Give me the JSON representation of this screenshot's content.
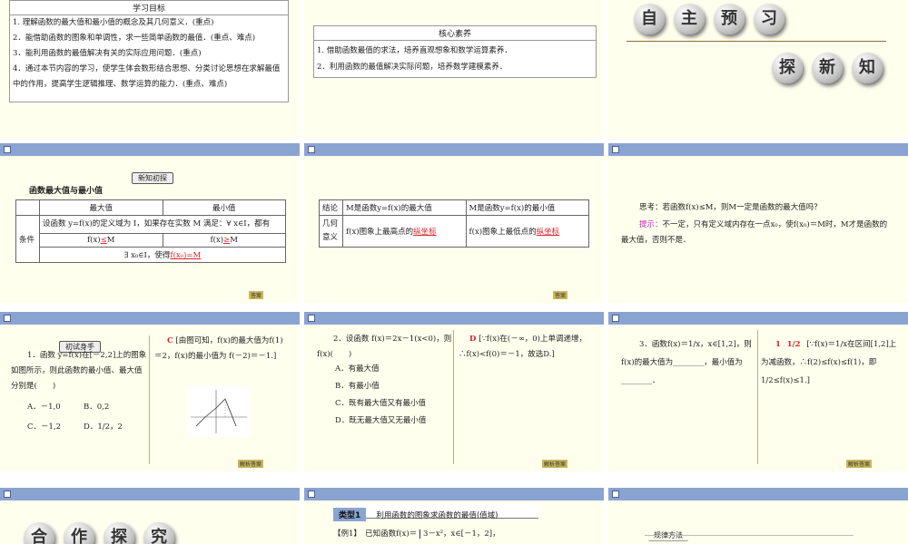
{
  "s1": {
    "title": "学习目标",
    "items": [
      "1. 理解函数的最大值和最小值的概念及其几何意义．(重点)",
      "2．能借助函数的图象和单调性，求一些简单函数的最值．(重点、难点)",
      "3．能利用函数的最值解决有关的实际应用问题．(重点)",
      "4．通过本节内容的学习，使学生体会数形结合思想、分类讨论思想在求解最值中的作用，提高学生逻辑推理、数学运算的能力．(重点、难点)"
    ]
  },
  "s2": {
    "title": "核心素养",
    "items": [
      "1. 借助函数最值的求法，培养直观想象和数学运算素养．",
      "2．利用函数的最值解决实际问题，培养数学建模素养．"
    ]
  },
  "s3": {
    "balls1": [
      "自",
      "主",
      "预",
      "习"
    ],
    "balls2": [
      "探",
      "新",
      "知"
    ]
  },
  "s4": {
    "pill": "新知初探",
    "subtitle": "函数最大值与最小值",
    "col_max": "最大值",
    "col_min": "最小值",
    "row_label": "条件",
    "cond": "设函数 y=f(x)的定义域为 I，如果存在实数 M 满足：∀ x∈I，都有",
    "c_max": "f(x)",
    "c_max_fill": "≤",
    "c_m": "M",
    "c_min": "f(x)",
    "c_min_fill": "≥",
    "c_m2": "M",
    "exist": "∃ x₀∈I，使得",
    "exist_fill": "f(x₀)=M",
    "tag": "答案"
  },
  "s5": {
    "r1_label": "结论",
    "r1_max": "M是函数y=f(x)的最大值",
    "r1_min": "M是函数y=f(x)的最小值",
    "r2_label": "几何意义",
    "r2_max_pre": "f(x)图象上最高点的",
    "r2_max_fill": "纵坐标",
    "r2_min_pre": "f(x)图象上最低点的",
    "r2_min_fill": "纵坐标",
    "tag": "答案"
  },
  "s6": {
    "q": "思考：若函数f(x)≤M，则M一定是函数的最大值吗？",
    "hint_label": "提示：",
    "hint": "不一定，只有定义域内存在一点x₀，使f(x₀)＝M时，M才是函数的最大值，否则不是．"
  },
  "s7": {
    "pill": "初试身手",
    "q": "1．函数 y=f(x)在[－2,2]上的图象如图所示，则此函数的最小值、最大值分别是(　　)",
    "oa": "A．－1,0",
    "ob": "B．0,2",
    "oc": "C．－1,2",
    "od": "D．1/2，2",
    "ans_letter": "C",
    "ans": "[由图可知，f(x)的最大值为f(1)＝2，f(x)的最小值为 f(－2)＝－1.]",
    "tag": "解析答案"
  },
  "s8": {
    "q": "2．设函数 f(x)＝2x－1(x<0)，则f(x)(　　)",
    "oa": "A．有最大值",
    "ob": "B．有最小值",
    "oc": "C．既有最大值又有最小值",
    "od": "D．既无最大值又无最小值",
    "ans_letter": "D",
    "ans": "[∵f(x)在(－∞，0)上单调递增，∴f(x)<f(0)＝－1，故选D.]",
    "tag": "解析答案"
  },
  "s9": {
    "q": "3．函数f(x)＝1/x，x∈[1,2]，则f(x)的最大值为________，最小值为________．",
    "ans1": "1",
    "ans2": "1/2",
    "ans": "[∵f(x)＝1/x在区间[1,2]上为减函数，∴f(2)≤f(x)≤f(1)，即1/2≤f(x)≤1.]",
    "tag": "解析答案"
  },
  "s10": {
    "balls": [
      "合",
      "作",
      "探",
      "究"
    ]
  },
  "s11": {
    "type_label": "类型1",
    "type_title": "利用函数的图象求函数的最值(值域)",
    "ex": "【例1】　已知函数f(x)＝",
    "ex_case": "3－x²，x∈[－1，2]，"
  },
  "s12": {
    "pill": "规律方法"
  }
}
